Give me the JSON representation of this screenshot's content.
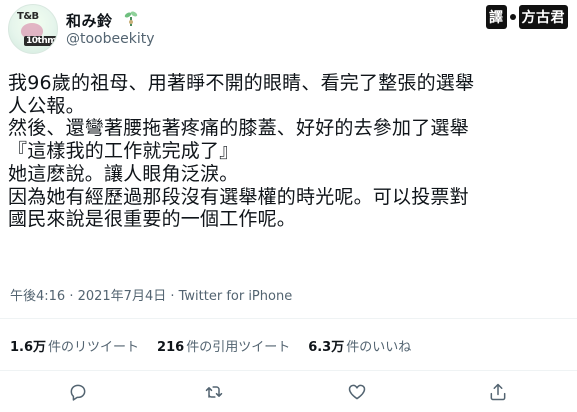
{
  "user": {
    "display_name": "和み鈴",
    "handle": "@toobeekity",
    "avatar_text_top": "T&B",
    "avatar_text_bottom": "10thm"
  },
  "badge": {
    "left": "譯",
    "right": "方古君"
  },
  "tweet": {
    "lines": [
      "我96歲的祖母、用著睜不開的眼睛、看完了整張的選舉",
      "人公報。",
      "然後、還彎著腰拖著疼痛的膝蓋、好好的去參加了選舉",
      "『這樣我的工作就完成了』",
      "她這麽說。讓人眼角泛淚。",
      "因為她有經歷過那段沒有選舉權的時光呢。可以投票對",
      "國民來說是很重要的一個工作呢。"
    ],
    "timestamp": "午後4:16 · 2021年7月4日 · Twitter for iPhone"
  },
  "stats": {
    "retweets": {
      "count": "1.6万",
      "label": "件のリツイート"
    },
    "quotes": {
      "count": "216",
      "label": "件の引用ツイート"
    },
    "likes": {
      "count": "6.3万",
      "label": "件のいいね"
    }
  },
  "icons": {
    "reply": "reply-icon",
    "retweet": "retweet-icon",
    "like": "heart-icon",
    "share": "share-icon"
  },
  "colors": {
    "text": "#0f1419",
    "secondary": "#536471",
    "divider": "#eff3f4"
  }
}
